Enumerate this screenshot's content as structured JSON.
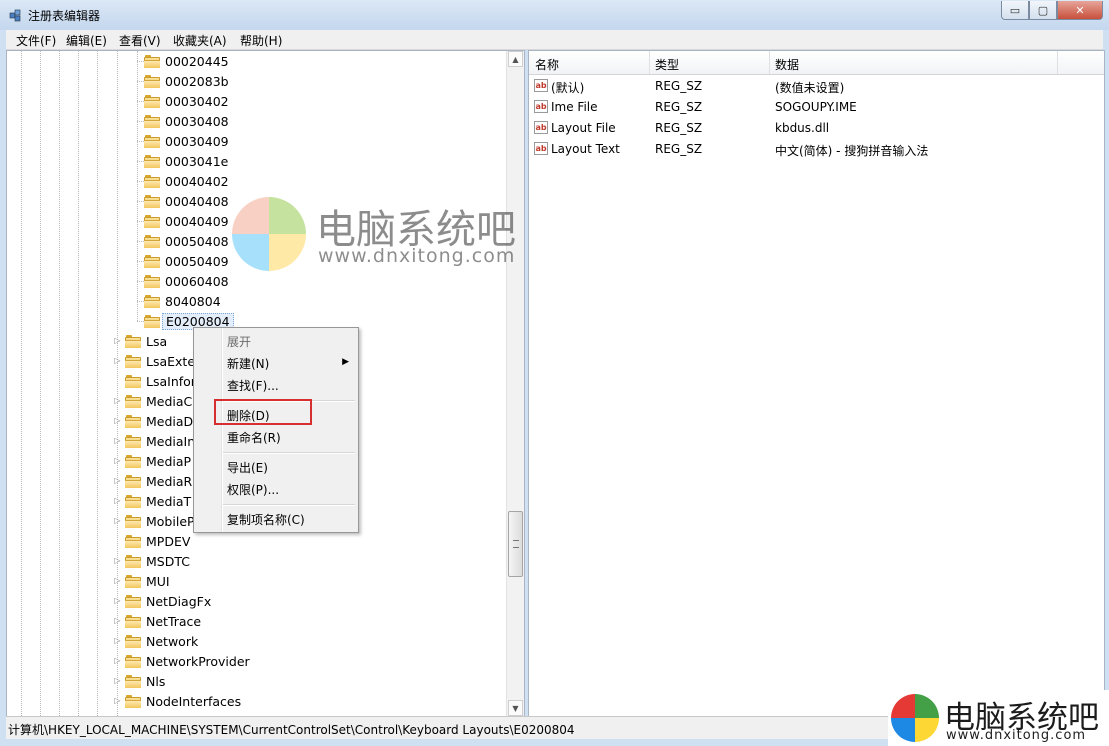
{
  "window": {
    "title": "注册表编辑器",
    "min_glyph": "▭",
    "max_glyph": "▢",
    "close_glyph": "✕"
  },
  "menubar": [
    "文件(F)",
    "编辑(E)",
    "查看(V)",
    "收藏夹(A)",
    "帮助(H)"
  ],
  "tree": {
    "subkeys": [
      "00020445",
      "0002083b",
      "00030402",
      "00030408",
      "00030409",
      "0003041e",
      "00040402",
      "00040408",
      "00040409",
      "00050408",
      "00050409",
      "00060408",
      "8040804",
      "E0200804"
    ],
    "selected": "E0200804",
    "siblings": [
      "Lsa",
      "LsaExte",
      "LsaInfor",
      "MediaC",
      "MediaD",
      "MediaIn",
      "MediaP",
      "MediaR",
      "MediaT",
      "MobileP",
      "MPDEV",
      "MSDTC",
      "MUI",
      "NetDiagFx",
      "NetTrace",
      "Network",
      "NetworkProvider",
      "Nls",
      "NodeInterfaces"
    ]
  },
  "list": {
    "columns": [
      "名称",
      "类型",
      "数据"
    ],
    "rows": [
      {
        "name": "(默认)",
        "type": "REG_SZ",
        "data": "(数值未设置)"
      },
      {
        "name": "Ime File",
        "type": "REG_SZ",
        "data": "SOGOUPY.IME"
      },
      {
        "name": "Layout File",
        "type": "REG_SZ",
        "data": "kbdus.dll"
      },
      {
        "name": "Layout Text",
        "type": "REG_SZ",
        "data": "中文(简体) - 搜狗拼音输入法"
      }
    ]
  },
  "context_menu": {
    "expand": "展开",
    "new": "新建(N)",
    "find": "查找(F)...",
    "delete": "删除(D)",
    "rename": "重命名(R)",
    "export": "导出(E)",
    "permissions": "权限(P)...",
    "copy_key_name": "复制项名称(C)"
  },
  "statusbar": "计算机\\HKEY_LOCAL_MACHINE\\SYSTEM\\CurrentControlSet\\Control\\Keyboard Layouts\\E0200804",
  "watermark": {
    "cn": "电脑系统吧",
    "url": "www.dnxitong.com"
  },
  "colors": {
    "highlight_box": "#d62f2f",
    "logo": [
      "#f4a58a",
      "#8cc63f",
      "#4fc3f7",
      "#ffd54f"
    ]
  }
}
